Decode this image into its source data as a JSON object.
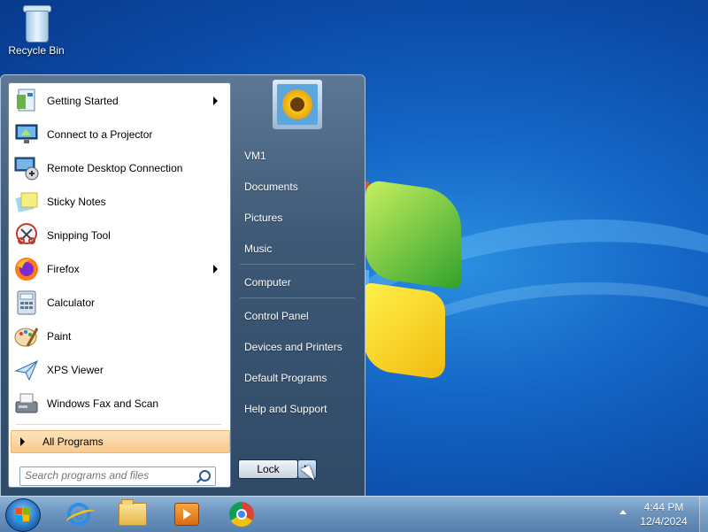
{
  "desktop": {
    "icons": [
      {
        "label": "Recycle Bin",
        "icon": "recycle-bin-icon"
      }
    ]
  },
  "start_menu": {
    "programs": [
      {
        "label": "Getting Started",
        "icon": "getting-started-icon",
        "has_submenu": true
      },
      {
        "label": "Connect to a Projector",
        "icon": "projector-icon",
        "has_submenu": false
      },
      {
        "label": "Remote Desktop Connection",
        "icon": "remote-desktop-icon",
        "has_submenu": false
      },
      {
        "label": "Sticky Notes",
        "icon": "sticky-notes-icon",
        "has_submenu": false
      },
      {
        "label": "Snipping Tool",
        "icon": "snipping-tool-icon",
        "has_submenu": false
      },
      {
        "label": "Firefox",
        "icon": "firefox-icon",
        "has_submenu": true
      },
      {
        "label": "Calculator",
        "icon": "calculator-icon",
        "has_submenu": false
      },
      {
        "label": "Paint",
        "icon": "paint-icon",
        "has_submenu": false
      },
      {
        "label": "XPS Viewer",
        "icon": "xps-viewer-icon",
        "has_submenu": false
      },
      {
        "label": "Windows Fax and Scan",
        "icon": "fax-scan-icon",
        "has_submenu": false
      }
    ],
    "all_programs_label": "All Programs",
    "search_placeholder": "Search programs and files",
    "right_links": [
      {
        "label": "VM1"
      },
      {
        "label": "Documents"
      },
      {
        "label": "Pictures"
      },
      {
        "label": "Music"
      },
      {
        "label": "Computer"
      },
      {
        "label": "Control Panel"
      },
      {
        "label": "Devices and Printers"
      },
      {
        "label": "Default Programs"
      },
      {
        "label": "Help and Support"
      }
    ],
    "power_button_label": "Lock"
  },
  "taskbar": {
    "pinned": [
      {
        "icon": "internet-explorer-icon"
      },
      {
        "icon": "file-explorer-icon"
      },
      {
        "icon": "media-player-icon"
      },
      {
        "icon": "chrome-icon"
      }
    ],
    "clock": {
      "time": "4:44 PM",
      "date": "12/4/2024"
    }
  },
  "colors": {
    "desktop_blue": "#1466c6",
    "start_menu": "#3d5875",
    "highlight": "#f9c98a",
    "taskbar": "#6d95bf"
  }
}
